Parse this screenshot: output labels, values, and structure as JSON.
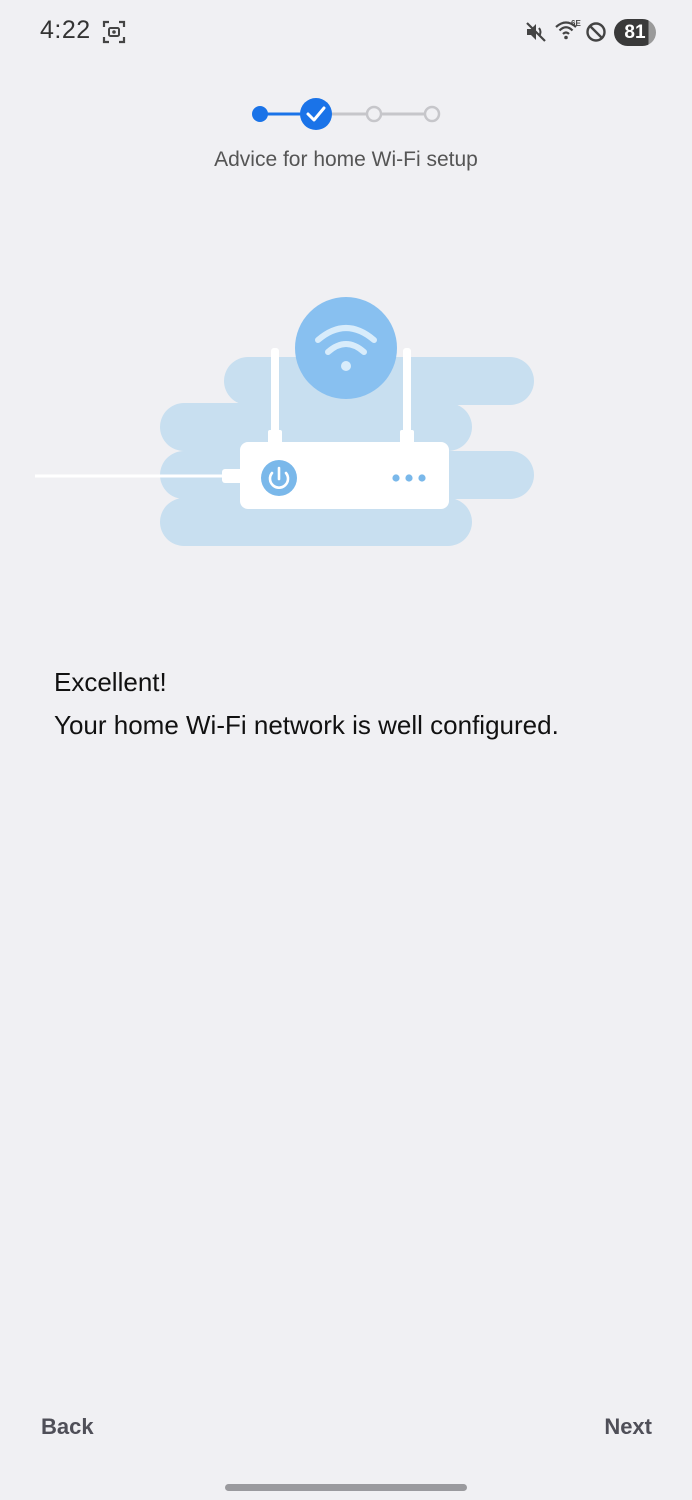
{
  "status_bar": {
    "time": "4:22",
    "wifi_badge": "6E",
    "battery_level": "81",
    "icons": [
      "screenshot-icon",
      "mute-icon",
      "wifi-icon",
      "do-not-disturb-icon"
    ]
  },
  "stepper": {
    "step_count": 4,
    "current_step": 2,
    "title": "Advice for home Wi-Fi setup"
  },
  "result": {
    "title": "Excellent!",
    "message": "Your home Wi-Fi network is well configured."
  },
  "footer": {
    "back_label": "Back",
    "next_label": "Next"
  },
  "colors": {
    "accent": "#1a73e8",
    "illustration_light": "#c8dff0",
    "illustration_bubble": "#88c0f0",
    "background": "#f0f0f3"
  }
}
